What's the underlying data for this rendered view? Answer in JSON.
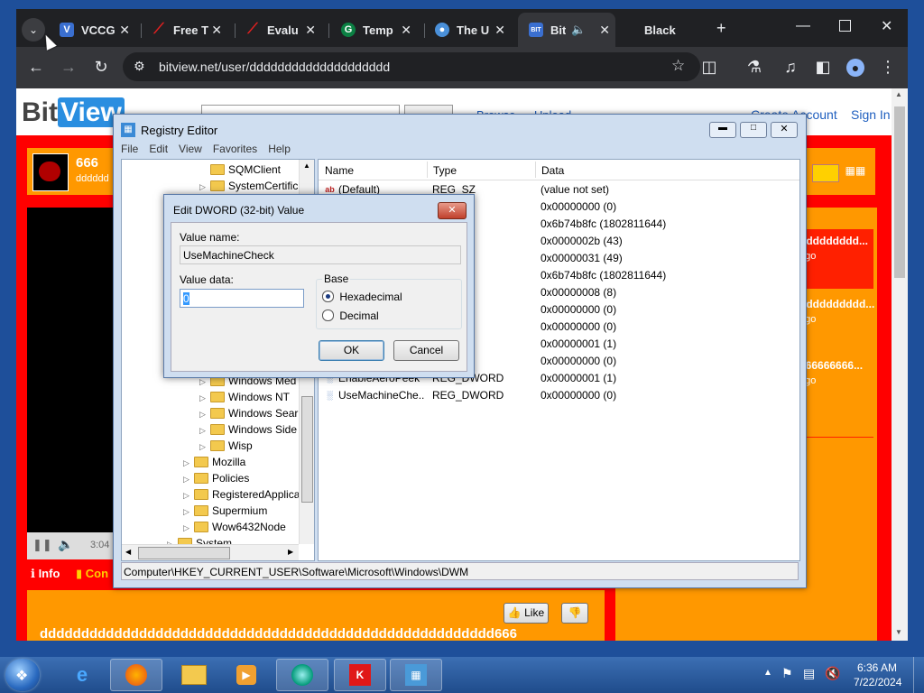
{
  "browser": {
    "tabs": [
      {
        "title": "VCCG",
        "favicon": "V"
      },
      {
        "title": "Free T",
        "favicon": "slash"
      },
      {
        "title": "Evalu",
        "favicon": "slash"
      },
      {
        "title": "Temp",
        "favicon": "G"
      },
      {
        "title": "The U",
        "favicon": "chat"
      },
      {
        "title": "Bit",
        "favicon": "Bit"
      },
      {
        "title": "Black",
        "favicon": ""
      }
    ],
    "url": "bitview.net/user/dddddddddddddddddddd"
  },
  "bitview": {
    "logo_bit": "Bit",
    "logo_view": "View",
    "nav_browse": "Browse",
    "nav_upload": "Upload",
    "create_account": "Create Account",
    "sign_in": "Sign In",
    "channel_name": "666",
    "channel_sub": "dddddd",
    "video_time": "3:04",
    "tab_info": "Info",
    "tab_comments": "Con",
    "like_label": "Like",
    "bottom_text": "ddddddddddddddddddddddddddddddddddddddddddddddddddddddd666",
    "side_items": [
      {
        "title": "ddddddddd...",
        "meta": "ago"
      },
      {
        "title": "dddddddddd...",
        "meta": "ago"
      },
      {
        "title": "666666666...",
        "meta": "ago"
      }
    ]
  },
  "regedit": {
    "title": "Registry Editor",
    "menu": [
      "File",
      "Edit",
      "View",
      "Favorites",
      "Help"
    ],
    "tree_top": [
      "SQMClient",
      "SystemCertific"
    ],
    "tree_bottom": [
      {
        "label": "Windows Med",
        "indent": 2
      },
      {
        "label": "Windows NT",
        "indent": 2
      },
      {
        "label": "Windows Sear",
        "indent": 2
      },
      {
        "label": "Windows Side",
        "indent": 2
      },
      {
        "label": "Wisp",
        "indent": 2
      },
      {
        "label": "Mozilla",
        "indent": 1
      },
      {
        "label": "Policies",
        "indent": 1
      },
      {
        "label": "RegisteredApplica",
        "indent": 1
      },
      {
        "label": "Supermium",
        "indent": 1
      },
      {
        "label": "Wow6432Node",
        "indent": 1
      },
      {
        "label": "System",
        "indent": 0
      }
    ],
    "columns": [
      "Name",
      "Type",
      "Data"
    ],
    "rows": [
      {
        "name": "(Default)",
        "type": "REG_SZ",
        "data": "(value not set)"
      },
      {
        "name": "",
        "type": "ORD",
        "data": "0x00000000 (0)"
      },
      {
        "name": "",
        "type": "ORD",
        "data": "0x6b74b8fc (1802811644)"
      },
      {
        "name": "",
        "type": "ORD",
        "data": "0x0000002b (43)"
      },
      {
        "name": "",
        "type": "ORD",
        "data": "0x00000031 (49)"
      },
      {
        "name": "",
        "type": "ORD",
        "data": "0x6b74b8fc (1802811644)"
      },
      {
        "name": "",
        "type": "ORD",
        "data": "0x00000008 (8)"
      },
      {
        "name": "",
        "type": "ORD",
        "data": "0x00000000 (0)"
      },
      {
        "name": "",
        "type": "ORD",
        "data": "0x00000000 (0)"
      },
      {
        "name": "",
        "type": "ORD",
        "data": "0x00000001 (1)"
      },
      {
        "name": "",
        "type": "ORD",
        "data": "0x00000000 (0)"
      },
      {
        "name": "EnableAeroPeek",
        "type": "REG_DWORD",
        "data": "0x00000001 (1)"
      },
      {
        "name": "UseMachineChe...",
        "type": "REG_DWORD",
        "data": "0x00000000 (0)"
      }
    ],
    "status_path": "Computer\\HKEY_CURRENT_USER\\Software\\Microsoft\\Windows\\DWM"
  },
  "dialog": {
    "title": "Edit DWORD (32-bit) Value",
    "value_name_label": "Value name:",
    "value_name": "UseMachineCheck",
    "value_data_label": "Value data:",
    "value_data": "0",
    "base_label": "Base",
    "base_hex": "Hexadecimal",
    "base_dec": "Decimal",
    "base_selected": "Hexadecimal",
    "ok": "OK",
    "cancel": "Cancel"
  },
  "taskbar": {
    "clock_time": "6:36 AM",
    "clock_date": "7/22/2024"
  },
  "colors": {
    "bitview_red": "#ff0000",
    "bitview_orange": "#ff9800",
    "chrome_dark": "#202124",
    "taskbar_blue": "#2a5aa0"
  }
}
